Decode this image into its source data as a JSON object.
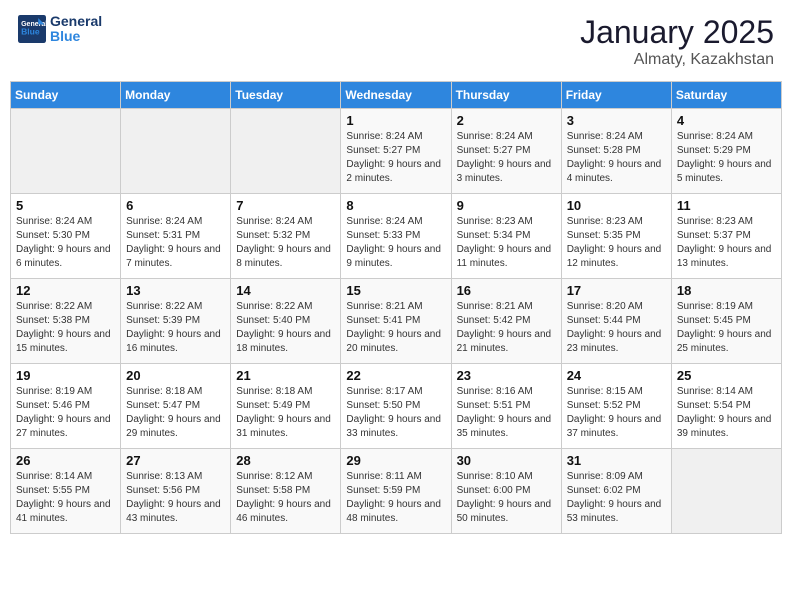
{
  "header": {
    "logo_line1": "General",
    "logo_line2": "Blue",
    "month": "January 2025",
    "location": "Almaty, Kazakhstan"
  },
  "days_of_week": [
    "Sunday",
    "Monday",
    "Tuesday",
    "Wednesday",
    "Thursday",
    "Friday",
    "Saturday"
  ],
  "weeks": [
    [
      {
        "day": "",
        "sunrise": "",
        "sunset": "",
        "daylight": ""
      },
      {
        "day": "",
        "sunrise": "",
        "sunset": "",
        "daylight": ""
      },
      {
        "day": "",
        "sunrise": "",
        "sunset": "",
        "daylight": ""
      },
      {
        "day": "1",
        "sunrise": "Sunrise: 8:24 AM",
        "sunset": "Sunset: 5:27 PM",
        "daylight": "Daylight: 9 hours and 2 minutes."
      },
      {
        "day": "2",
        "sunrise": "Sunrise: 8:24 AM",
        "sunset": "Sunset: 5:27 PM",
        "daylight": "Daylight: 9 hours and 3 minutes."
      },
      {
        "day": "3",
        "sunrise": "Sunrise: 8:24 AM",
        "sunset": "Sunset: 5:28 PM",
        "daylight": "Daylight: 9 hours and 4 minutes."
      },
      {
        "day": "4",
        "sunrise": "Sunrise: 8:24 AM",
        "sunset": "Sunset: 5:29 PM",
        "daylight": "Daylight: 9 hours and 5 minutes."
      }
    ],
    [
      {
        "day": "5",
        "sunrise": "Sunrise: 8:24 AM",
        "sunset": "Sunset: 5:30 PM",
        "daylight": "Daylight: 9 hours and 6 minutes."
      },
      {
        "day": "6",
        "sunrise": "Sunrise: 8:24 AM",
        "sunset": "Sunset: 5:31 PM",
        "daylight": "Daylight: 9 hours and 7 minutes."
      },
      {
        "day": "7",
        "sunrise": "Sunrise: 8:24 AM",
        "sunset": "Sunset: 5:32 PM",
        "daylight": "Daylight: 9 hours and 8 minutes."
      },
      {
        "day": "8",
        "sunrise": "Sunrise: 8:24 AM",
        "sunset": "Sunset: 5:33 PM",
        "daylight": "Daylight: 9 hours and 9 minutes."
      },
      {
        "day": "9",
        "sunrise": "Sunrise: 8:23 AM",
        "sunset": "Sunset: 5:34 PM",
        "daylight": "Daylight: 9 hours and 11 minutes."
      },
      {
        "day": "10",
        "sunrise": "Sunrise: 8:23 AM",
        "sunset": "Sunset: 5:35 PM",
        "daylight": "Daylight: 9 hours and 12 minutes."
      },
      {
        "day": "11",
        "sunrise": "Sunrise: 8:23 AM",
        "sunset": "Sunset: 5:37 PM",
        "daylight": "Daylight: 9 hours and 13 minutes."
      }
    ],
    [
      {
        "day": "12",
        "sunrise": "Sunrise: 8:22 AM",
        "sunset": "Sunset: 5:38 PM",
        "daylight": "Daylight: 9 hours and 15 minutes."
      },
      {
        "day": "13",
        "sunrise": "Sunrise: 8:22 AM",
        "sunset": "Sunset: 5:39 PM",
        "daylight": "Daylight: 9 hours and 16 minutes."
      },
      {
        "day": "14",
        "sunrise": "Sunrise: 8:22 AM",
        "sunset": "Sunset: 5:40 PM",
        "daylight": "Daylight: 9 hours and 18 minutes."
      },
      {
        "day": "15",
        "sunrise": "Sunrise: 8:21 AM",
        "sunset": "Sunset: 5:41 PM",
        "daylight": "Daylight: 9 hours and 20 minutes."
      },
      {
        "day": "16",
        "sunrise": "Sunrise: 8:21 AM",
        "sunset": "Sunset: 5:42 PM",
        "daylight": "Daylight: 9 hours and 21 minutes."
      },
      {
        "day": "17",
        "sunrise": "Sunrise: 8:20 AM",
        "sunset": "Sunset: 5:44 PM",
        "daylight": "Daylight: 9 hours and 23 minutes."
      },
      {
        "day": "18",
        "sunrise": "Sunrise: 8:19 AM",
        "sunset": "Sunset: 5:45 PM",
        "daylight": "Daylight: 9 hours and 25 minutes."
      }
    ],
    [
      {
        "day": "19",
        "sunrise": "Sunrise: 8:19 AM",
        "sunset": "Sunset: 5:46 PM",
        "daylight": "Daylight: 9 hours and 27 minutes."
      },
      {
        "day": "20",
        "sunrise": "Sunrise: 8:18 AM",
        "sunset": "Sunset: 5:47 PM",
        "daylight": "Daylight: 9 hours and 29 minutes."
      },
      {
        "day": "21",
        "sunrise": "Sunrise: 8:18 AM",
        "sunset": "Sunset: 5:49 PM",
        "daylight": "Daylight: 9 hours and 31 minutes."
      },
      {
        "day": "22",
        "sunrise": "Sunrise: 8:17 AM",
        "sunset": "Sunset: 5:50 PM",
        "daylight": "Daylight: 9 hours and 33 minutes."
      },
      {
        "day": "23",
        "sunrise": "Sunrise: 8:16 AM",
        "sunset": "Sunset: 5:51 PM",
        "daylight": "Daylight: 9 hours and 35 minutes."
      },
      {
        "day": "24",
        "sunrise": "Sunrise: 8:15 AM",
        "sunset": "Sunset: 5:52 PM",
        "daylight": "Daylight: 9 hours and 37 minutes."
      },
      {
        "day": "25",
        "sunrise": "Sunrise: 8:14 AM",
        "sunset": "Sunset: 5:54 PM",
        "daylight": "Daylight: 9 hours and 39 minutes."
      }
    ],
    [
      {
        "day": "26",
        "sunrise": "Sunrise: 8:14 AM",
        "sunset": "Sunset: 5:55 PM",
        "daylight": "Daylight: 9 hours and 41 minutes."
      },
      {
        "day": "27",
        "sunrise": "Sunrise: 8:13 AM",
        "sunset": "Sunset: 5:56 PM",
        "daylight": "Daylight: 9 hours and 43 minutes."
      },
      {
        "day": "28",
        "sunrise": "Sunrise: 8:12 AM",
        "sunset": "Sunset: 5:58 PM",
        "daylight": "Daylight: 9 hours and 46 minutes."
      },
      {
        "day": "29",
        "sunrise": "Sunrise: 8:11 AM",
        "sunset": "Sunset: 5:59 PM",
        "daylight": "Daylight: 9 hours and 48 minutes."
      },
      {
        "day": "30",
        "sunrise": "Sunrise: 8:10 AM",
        "sunset": "Sunset: 6:00 PM",
        "daylight": "Daylight: 9 hours and 50 minutes."
      },
      {
        "day": "31",
        "sunrise": "Sunrise: 8:09 AM",
        "sunset": "Sunset: 6:02 PM",
        "daylight": "Daylight: 9 hours and 53 minutes."
      },
      {
        "day": "",
        "sunrise": "",
        "sunset": "",
        "daylight": ""
      }
    ]
  ]
}
